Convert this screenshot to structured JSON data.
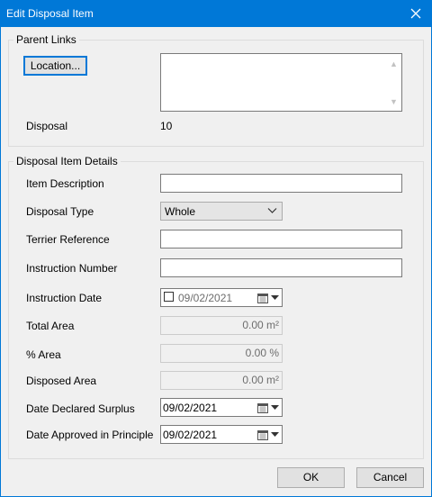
{
  "window": {
    "title": "Edit Disposal Item"
  },
  "parent_links": {
    "legend": "Parent Links",
    "location_button": "Location...",
    "disposal_label": "Disposal",
    "disposal_value": "10"
  },
  "details": {
    "legend": "Disposal Item Details",
    "item_description_label": "Item Description",
    "item_description_value": "",
    "disposal_type_label": "Disposal Type",
    "disposal_type_value": "Whole",
    "terrier_reference_label": "Terrier Reference",
    "terrier_reference_value": "",
    "instruction_number_label": "Instruction Number",
    "instruction_number_value": "",
    "instruction_date_label": "Instruction Date",
    "instruction_date_value": "09/02/2021",
    "total_area_label": "Total Area",
    "total_area_value": "0.00 m²",
    "percent_area_label": "% Area",
    "percent_area_value": "0.00 %",
    "disposed_area_label": "Disposed Area",
    "disposed_area_value": "0.00 m²",
    "date_declared_surplus_label": "Date Declared Surplus",
    "date_declared_surplus_value": "09/02/2021",
    "date_approved_label": "Date Approved in Principle",
    "date_approved_value": "09/02/2021"
  },
  "buttons": {
    "ok": "OK",
    "cancel": "Cancel"
  },
  "icons": {
    "close": "close-icon",
    "dropdown": "chevron-down-icon",
    "calendar": "calendar-icon",
    "scroll_up": "scroll-up-arrow-icon",
    "scroll_down": "scroll-down-arrow-icon"
  },
  "colors": {
    "titlebar": "#0078d7",
    "focus": "#0078d7",
    "window_bg": "#f0f0f0"
  }
}
